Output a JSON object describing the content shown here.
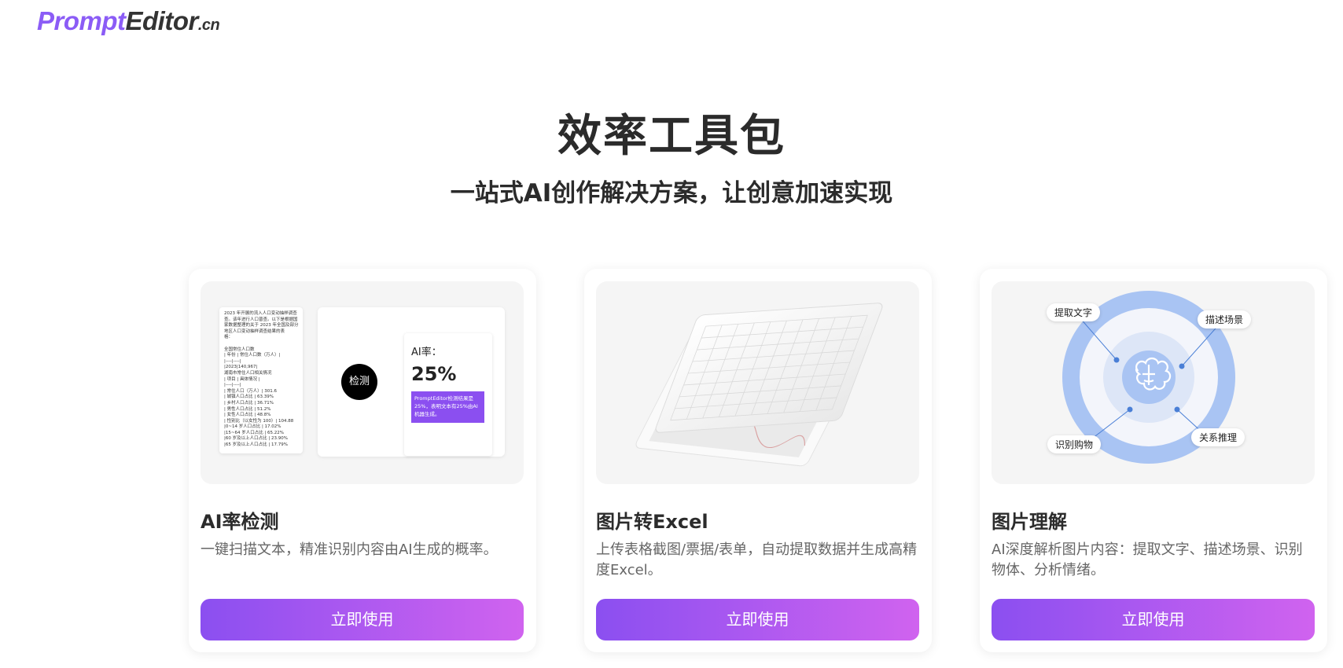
{
  "logo": {
    "prompt": "Prompt",
    "editor": "Editor",
    "cn": ".cn"
  },
  "header": {
    "title": "效率工具包",
    "subtitle": "一站式AI创作解决方案，让创意加速实现"
  },
  "cards": [
    {
      "title": "AI率检测",
      "desc": "一键扫描文本，精准识别内容由AI生成的概率。",
      "button": "立即使用",
      "illustration": {
        "doc_text": "2023 年开展的流入人口变动抽样调查\n查。该年进行人口普查。以下是根据国\n家数据整理的关于 2023 年全国及部分\n地区人口变动抽样调查结果的表\n格：\n\n全国常住人口数\n| 年份 | 常住人口数（万人）|\n|----|----|\n|2023|140,967|\n湖南市常住人口相关情况\n| 项目 | 具体情况 |\n|----|----|\n| 常住人口（万人）| 301.6\n| 城镇人口占比 | 63.39%\n| 乡村人口占比 | 36.71%\n| 男性人口占比 | 51.2%\n| 女性人口占比 | 48.8%\n| 性别比（以女性为 100）| 104.88\n|0~14 岁人口占比 | 17.02%\n|15~64 岁人口占比 | 65.22%\n|60 岁及以上人口占比 | 23.90%\n|65 岁及以上人口占比 | 17.79%",
        "detect_label": "检测",
        "rate_label": "AI率：",
        "rate_value": "25%",
        "note": "PromptEditor检测结果是25%，表明文本有25%由AI机器生成。"
      }
    },
    {
      "title": "图片转Excel",
      "desc": "上传表格截图/票据/表单，自动提取数据并生成高精度Excel。",
      "button": "立即使用"
    },
    {
      "title": "图片理解",
      "desc": "AI深度解析图片内容：提取文字、描述场景、识别物体、分析情绪。",
      "button": "立即使用",
      "illustration": {
        "tags": [
          "提取文字",
          "描述场景",
          "识别购物",
          "关系推理"
        ]
      }
    }
  ],
  "colors": {
    "brand": "#8b5cf6",
    "button_start": "#8b4ff0",
    "button_end": "#d063ef",
    "ring": "#a9c4f3"
  }
}
